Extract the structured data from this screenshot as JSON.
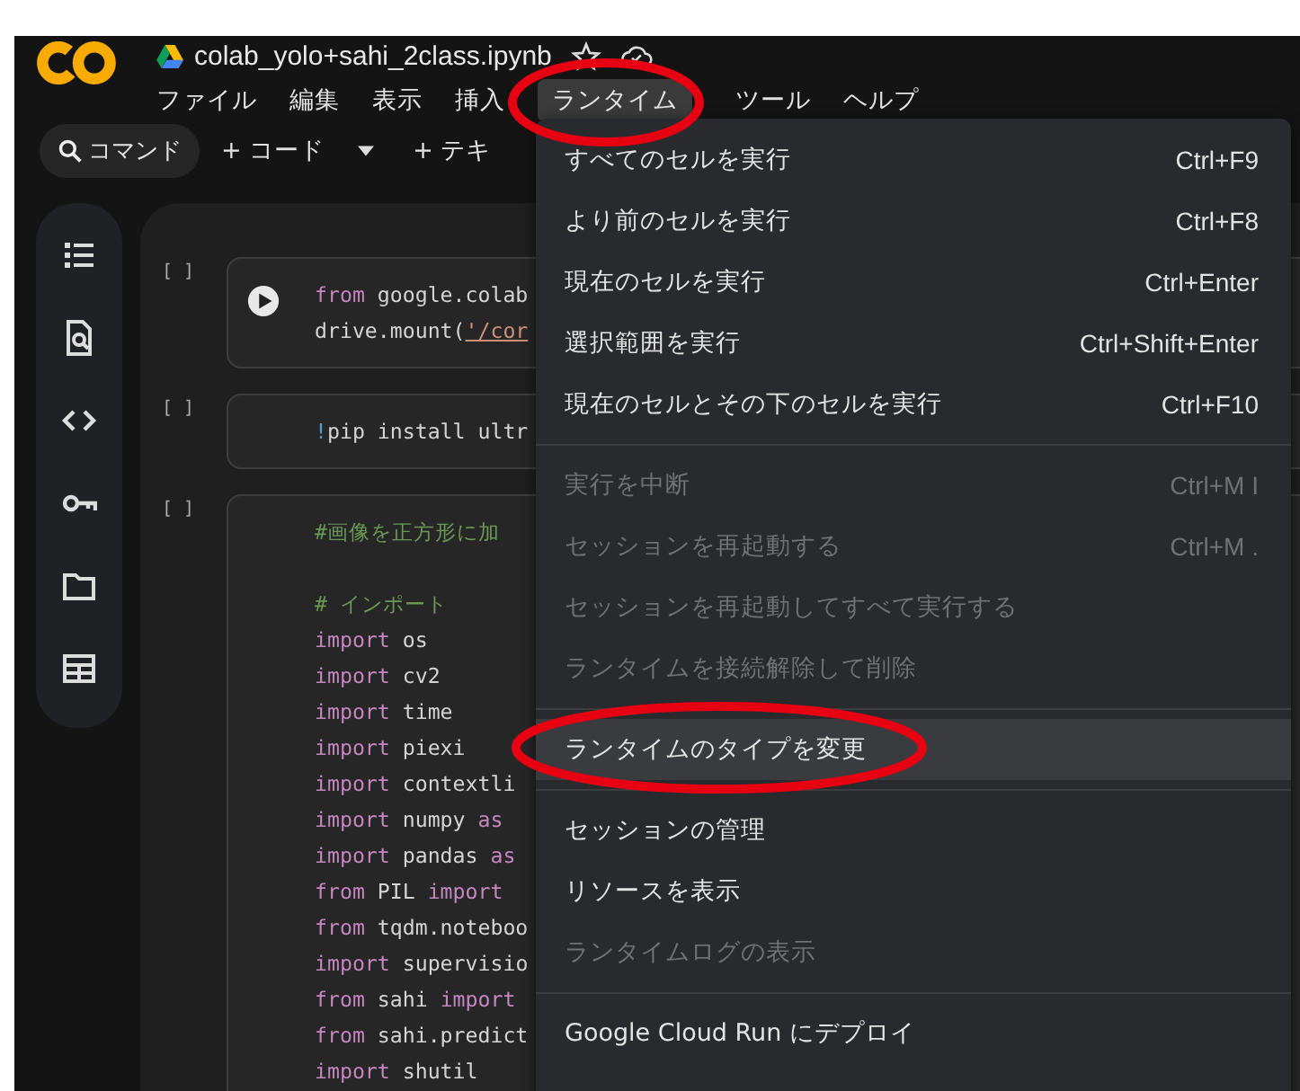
{
  "header": {
    "title": "colab_yolo+sahi_2class.ipynb"
  },
  "menubar": [
    {
      "label": "ファイル",
      "selected": false
    },
    {
      "label": "編集",
      "selected": false
    },
    {
      "label": "表示",
      "selected": false
    },
    {
      "label": "挿入",
      "selected": false
    },
    {
      "label": "ランタイム",
      "selected": true
    },
    {
      "label": "ツール",
      "selected": false
    },
    {
      "label": "ヘルプ",
      "selected": false
    }
  ],
  "toolbar": {
    "search_label": "コマンド",
    "add_code": "+ コード",
    "add_text": "+ テキ"
  },
  "cells": [
    {
      "status": "[ ]",
      "run_button": true,
      "lines": [
        [
          {
            "kind": "keyword",
            "text": "from"
          },
          {
            "kind": "plain",
            "text": " google.colab"
          }
        ],
        [
          {
            "kind": "plain",
            "text": "drive.mount("
          },
          {
            "kind": "string",
            "text": "'/cor"
          }
        ]
      ]
    },
    {
      "status": "[ ]",
      "run_button": false,
      "lines": [
        [
          {
            "kind": "bang",
            "text": "!"
          },
          {
            "kind": "plain",
            "text": "pip install ultr"
          }
        ]
      ]
    },
    {
      "status": "[ ]",
      "run_button": false,
      "lines": [
        [
          {
            "kind": "comment",
            "text": "#画像を正方形に加"
          }
        ],
        [
          {
            "kind": "blank"
          }
        ],
        [
          {
            "kind": "comment",
            "text": "# インポート"
          }
        ],
        [
          {
            "kind": "keyword",
            "text": "import"
          },
          {
            "kind": "plain",
            "text": " os"
          }
        ],
        [
          {
            "kind": "keyword",
            "text": "import"
          },
          {
            "kind": "plain",
            "text": " cv2"
          }
        ],
        [
          {
            "kind": "keyword",
            "text": "import"
          },
          {
            "kind": "plain",
            "text": " time"
          }
        ],
        [
          {
            "kind": "keyword",
            "text": "import"
          },
          {
            "kind": "plain",
            "text": " piexi"
          }
        ],
        [
          {
            "kind": "keyword",
            "text": "import"
          },
          {
            "kind": "plain",
            "text": " contextli"
          }
        ],
        [
          {
            "kind": "keyword",
            "text": "import"
          },
          {
            "kind": "plain",
            "text": " numpy "
          },
          {
            "kind": "keyword",
            "text": "as"
          }
        ],
        [
          {
            "kind": "keyword",
            "text": "import"
          },
          {
            "kind": "plain",
            "text": " pandas "
          },
          {
            "kind": "keyword",
            "text": "as"
          }
        ],
        [
          {
            "kind": "keyword",
            "text": "from"
          },
          {
            "kind": "plain",
            "text": " PIL "
          },
          {
            "kind": "keyword",
            "text": "import"
          }
        ],
        [
          {
            "kind": "keyword",
            "text": "from"
          },
          {
            "kind": "plain",
            "text": " tqdm.noteboo"
          }
        ],
        [
          {
            "kind": "keyword",
            "text": "import"
          },
          {
            "kind": "plain",
            "text": " supervisio"
          }
        ],
        [
          {
            "kind": "keyword",
            "text": "from"
          },
          {
            "kind": "plain",
            "text": " sahi "
          },
          {
            "kind": "keyword",
            "text": "import"
          }
        ],
        [
          {
            "kind": "keyword",
            "text": "from"
          },
          {
            "kind": "plain",
            "text": " sahi.predict"
          }
        ],
        [
          {
            "kind": "keyword",
            "text": "import"
          },
          {
            "kind": "plain",
            "text": " shutil"
          }
        ]
      ]
    }
  ],
  "runtime_menu": [
    {
      "kind": "item",
      "label": "すべてのセルを実行",
      "shortcut": "Ctrl+F9",
      "disabled": false,
      "selected": false
    },
    {
      "kind": "item",
      "label": "より前のセルを実行",
      "shortcut": "Ctrl+F8",
      "disabled": false,
      "selected": false
    },
    {
      "kind": "item",
      "label": "現在のセルを実行",
      "shortcut": "Ctrl+Enter",
      "disabled": false,
      "selected": false
    },
    {
      "kind": "item",
      "label": "選択範囲を実行",
      "shortcut": "Ctrl+Shift+Enter",
      "disabled": false,
      "selected": false
    },
    {
      "kind": "item",
      "label": "現在のセルとその下のセルを実行",
      "shortcut": "Ctrl+F10",
      "disabled": false,
      "selected": false
    },
    {
      "kind": "separator"
    },
    {
      "kind": "item",
      "label": "実行を中断",
      "shortcut": "Ctrl+M I",
      "disabled": true,
      "selected": false
    },
    {
      "kind": "item",
      "label": "セッションを再起動する",
      "shortcut": "Ctrl+M .",
      "disabled": true,
      "selected": false
    },
    {
      "kind": "item",
      "label": "セッションを再起動してすべて実行する",
      "disabled": true,
      "selected": false
    },
    {
      "kind": "item",
      "label": "ランタイムを接続解除して削除",
      "disabled": true,
      "selected": false
    },
    {
      "kind": "separator"
    },
    {
      "kind": "item",
      "label": "ランタイムのタイプを変更",
      "disabled": false,
      "selected": true
    },
    {
      "kind": "separator"
    },
    {
      "kind": "item",
      "label": "セッションの管理",
      "disabled": false,
      "selected": false
    },
    {
      "kind": "item",
      "label": "リソースを表示",
      "disabled": false,
      "selected": false
    },
    {
      "kind": "item",
      "label": "ランタイムログの表示",
      "disabled": true,
      "selected": false
    },
    {
      "kind": "separator"
    },
    {
      "kind": "item",
      "label": "Google Cloud Run にデプロイ",
      "disabled": false,
      "selected": false
    }
  ],
  "annotations": [
    {
      "kind": "ellipse"
    },
    {
      "kind": "ellipse"
    }
  ]
}
